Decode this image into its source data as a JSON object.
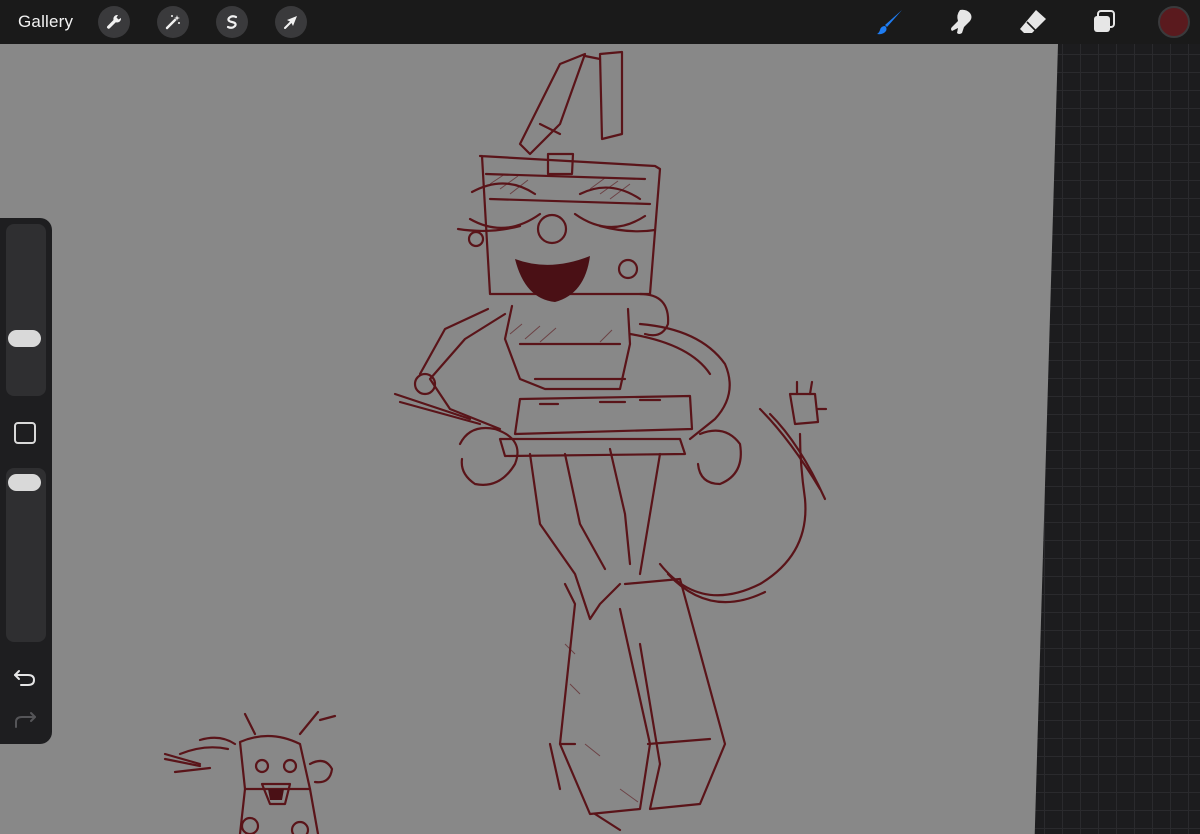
{
  "toolbar": {
    "gallery_label": "Gallery",
    "left_tools": [
      "wrench-icon",
      "magic-wand-icon",
      "selection-s-icon",
      "transform-arrow-icon"
    ],
    "right_tools": [
      "brush-icon",
      "smudge-icon",
      "eraser-icon",
      "layers-icon"
    ],
    "active_tool": "brush",
    "active_tool_color": "#1e7cf2",
    "current_color": "#5a1a1e"
  },
  "sidebar": {
    "brush_size": 0.63,
    "brush_opacity": 0.93,
    "undo_icon": "undo-icon",
    "redo_icon": "redo-icon"
  },
  "canvas": {
    "background_color": "#888888",
    "stroke_color": "#5a1419"
  }
}
